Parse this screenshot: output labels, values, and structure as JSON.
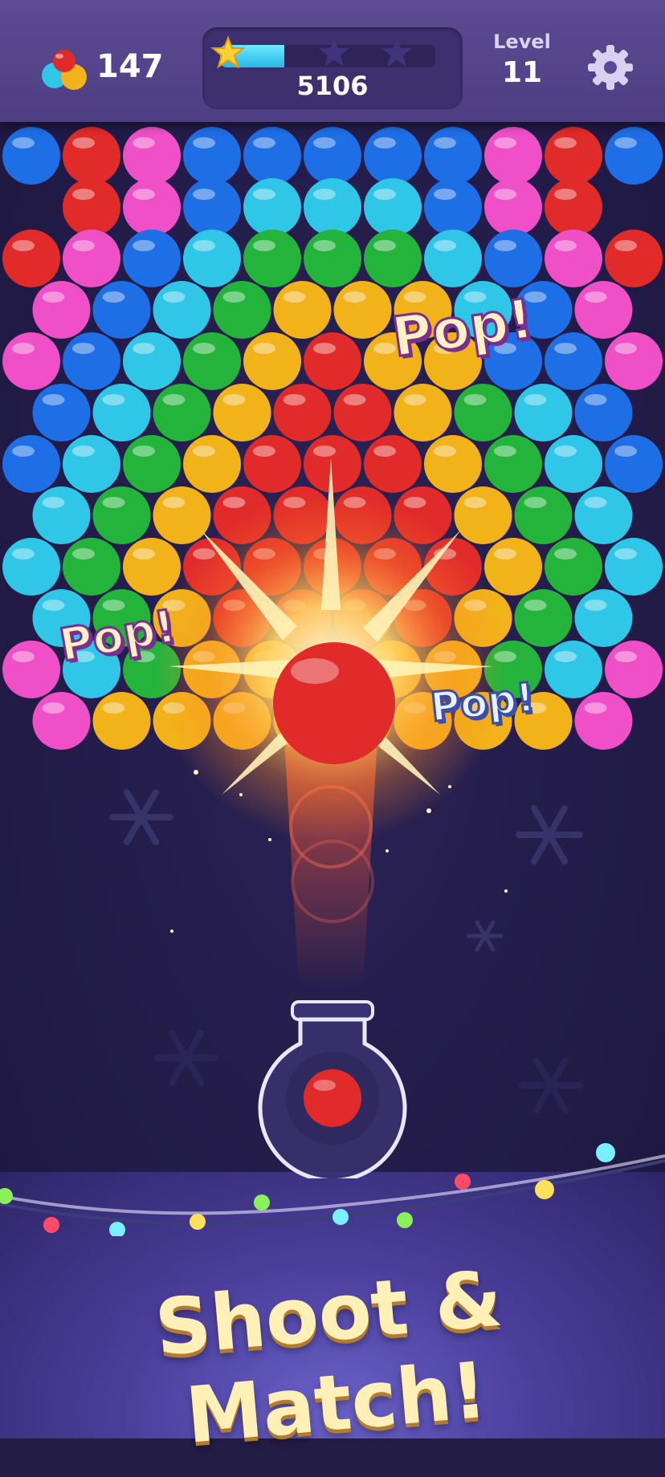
{
  "hud": {
    "balls_icon": "colored-balls-icon",
    "balls_count": "147",
    "score": "5106",
    "score_progress": 0.3,
    "stars_earned": 1,
    "stars_total": 3,
    "level_label": "Level",
    "level_number": "11",
    "settings_icon": "gear-icon"
  },
  "board": {
    "colors": {
      "B": "#1e6ee6",
      "R": "#e12a2a",
      "M": "#ef4fc7",
      "C": "#2fc6e8",
      "G": "#24b43c",
      "Y": "#f2b21a"
    },
    "rows": [
      "BRMBBBBBMRB",
      "RMBCCCBMR",
      "RMBCGGGCBMR",
      "MBCGYYYCBM",
      "MBCGYRYYBBM",
      "BCGYRRYGCB",
      "BCGYRRRYGCB",
      "CGYRRRRYGC",
      "CGYRRRRRYGC",
      "CGYRRRRYGC",
      "MCGYYYYYGCM",
      "MYYYYYYYYM"
    ]
  },
  "popups": [
    "Pop!",
    "Pop!",
    "Pop!"
  ],
  "shot_bubble_color": "#e12a2a",
  "next_bubble_color": "#e12a2a",
  "tagline": "Shoot & Match!"
}
